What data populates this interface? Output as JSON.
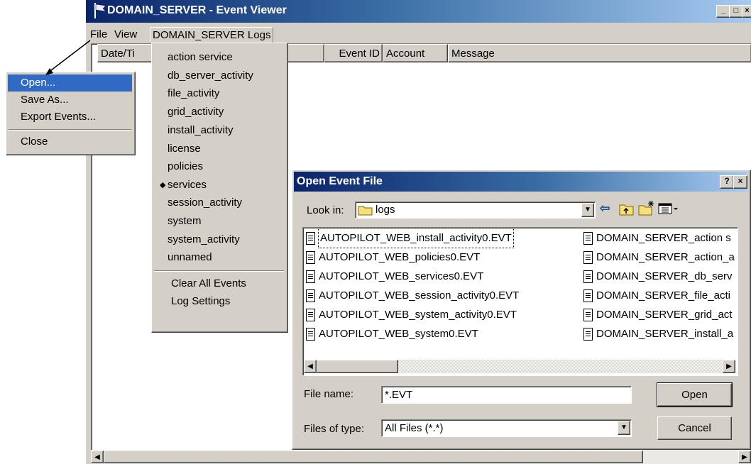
{
  "window": {
    "title": "DOMAIN_SERVER - Event Viewer",
    "caption_min": "_",
    "caption_max": "□",
    "caption_close": "×"
  },
  "menubar": {
    "file": "File",
    "view": "View",
    "logs": "DOMAIN_SERVER Logs"
  },
  "columns": [
    "Date/Ti",
    "Event ID",
    "Account",
    "Message"
  ],
  "file_menu": {
    "items": [
      "Open...",
      "Save As...",
      "Export Events...",
      "Close"
    ],
    "highlighted": "Open..."
  },
  "logs_menu": {
    "items": [
      "action service",
      "db_server_activity",
      "file_activity",
      "grid_activity",
      "install_activity",
      "license",
      "policies",
      "services",
      "session_activity",
      "system",
      "system_activity",
      "unnamed"
    ],
    "checked": "services",
    "bullet": "◆",
    "actions": [
      "Clear All Events",
      "Log Settings"
    ]
  },
  "dialog": {
    "title": "Open Event File",
    "help": "?",
    "close": "×",
    "look_in_label": "Look in:",
    "look_in_value": "logs",
    "files_left": [
      "AUTOPILOT_WEB_install_activity0.EVT",
      "AUTOPILOT_WEB_policies0.EVT",
      "AUTOPILOT_WEB_services0.EVT",
      "AUTOPILOT_WEB_session_activity0.EVT",
      "AUTOPILOT_WEB_system_activity0.EVT",
      "AUTOPILOT_WEB_system0.EVT"
    ],
    "files_right": [
      "DOMAIN_SERVER_action s",
      "DOMAIN_SERVER_action_a",
      "DOMAIN_SERVER_db_serv",
      "DOMAIN_SERVER_file_acti",
      "DOMAIN_SERVER_grid_act",
      "DOMAIN_SERVER_install_a"
    ],
    "file_name_label": "File name:",
    "file_name_value": "*.EVT",
    "files_of_type_label": "Files of type:",
    "files_of_type_value": "All Files (*.*)",
    "open_button": "Open",
    "cancel_button": "Cancel"
  },
  "icons": {
    "back": "⇦",
    "up_folder": "up-folder-icon",
    "new_folder": "new-folder-icon",
    "view_menu": "view-menu-icon",
    "dropdown": "▼",
    "scroll_left": "◀",
    "scroll_right": "▶"
  },
  "colors": {
    "titlebar_active": "#0a246a",
    "highlight": "#316ac5",
    "face": "#d4d0c8"
  }
}
